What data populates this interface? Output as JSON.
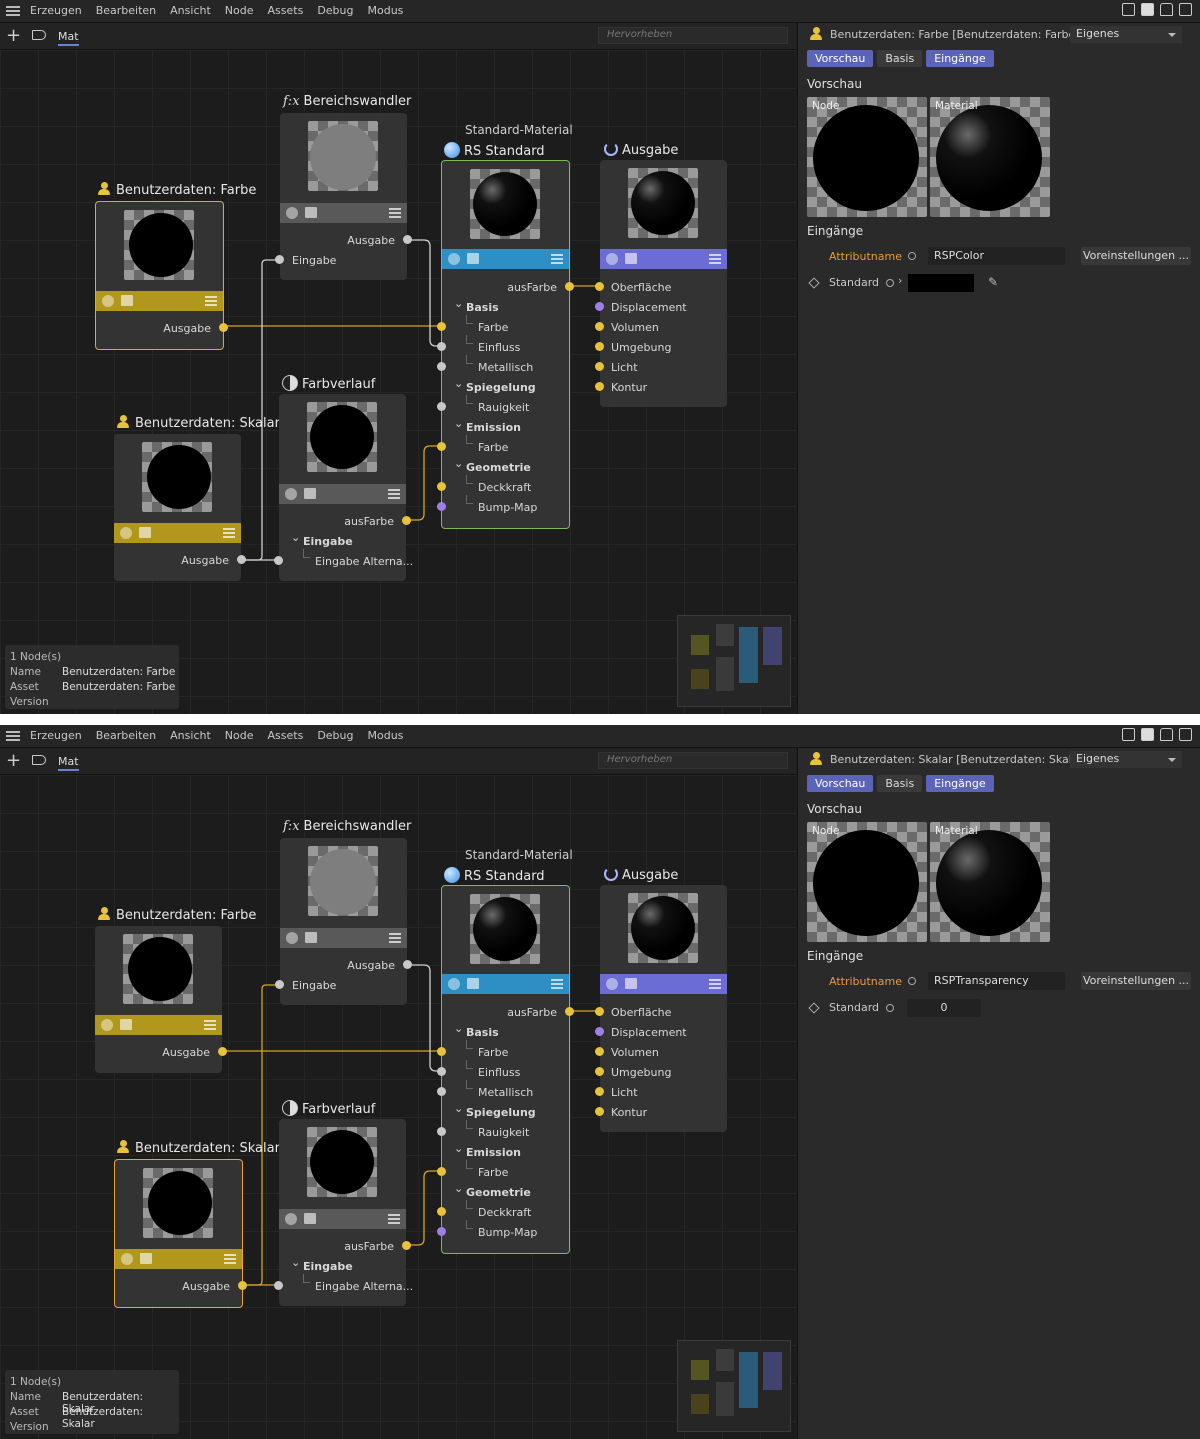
{
  "menu": [
    "Erzeugen",
    "Bearbeiten",
    "Ansicht",
    "Node",
    "Assets",
    "Debug",
    "Modus"
  ],
  "toolbar": {
    "tab": "Mat",
    "search_placeholder": "Hervorheben"
  },
  "nodes": {
    "range": {
      "title": "Bereichswandler",
      "out": "Ausgabe",
      "in": "Eingabe"
    },
    "farbe": {
      "title": "Benutzerdaten: Farbe",
      "out": "Ausgabe"
    },
    "skalar": {
      "title": "Benutzerdaten: Skalar",
      "out": "Ausgabe"
    },
    "gradient": {
      "title": "Farbverlauf",
      "out": "ausFarbe",
      "group": "Eingabe",
      "in": "Eingabe Alterna..."
    },
    "rs": {
      "subtitle": "Standard-Material",
      "title": "RS Standard",
      "out": "ausFarbe",
      "groups": [
        "Basis",
        "Spiegelung",
        "Emission",
        "Geometrie"
      ],
      "basis": [
        "Farbe",
        "Einfluss",
        "Metallisch"
      ],
      "spiegelung": [
        "Rauigkeit"
      ],
      "emission": [
        "Farbe"
      ],
      "geometrie": [
        "Deckkraft",
        "Bump-Map"
      ]
    },
    "out": {
      "title": "Ausgabe",
      "ports": [
        "Oberfläche",
        "Displacement",
        "Volumen",
        "Umgebung",
        "Licht",
        "Kontur"
      ]
    }
  },
  "colors": {
    "yellow_bar": "#b2971d",
    "grey_bar": "#595959",
    "rs_bar": "#2d8fc4",
    "out_bar": "#6b6dd4",
    "wire": "#d4a32a",
    "sel": "#e8a33c"
  },
  "shots": [
    {
      "info": {
        "count": "1 Node(s)",
        "name_lbl": "Name",
        "asset_lbl": "Asset",
        "version_lbl": "Version",
        "name": "Benutzerdaten: Farbe",
        "asset": "Benutzerdaten: Farbe"
      },
      "panel": {
        "title": "Benutzerdaten: Farbe [Benutzerdaten: Farbe]",
        "mode": "Eigenes",
        "tabs": [
          "Vorschau",
          "Basis",
          "Eingänge"
        ],
        "vorschau": "Vorschau",
        "node_lbl": "Node",
        "mat_lbl": "Material",
        "eingaenge": "Eingänge",
        "attr_lbl": "Attributname",
        "attr_val": "RSPColor",
        "preset": "Voreinstellungen ...",
        "std_lbl": "Standard",
        "std_val": ""
      }
    },
    {
      "info": {
        "count": "1 Node(s)",
        "name_lbl": "Name",
        "asset_lbl": "Asset",
        "version_lbl": "Version",
        "name": "Benutzerdaten: Skalar",
        "asset": "Benutzerdaten: Skalar"
      },
      "panel": {
        "title": "Benutzerdaten: Skalar [Benutzerdaten: Skalar]",
        "mode": "Eigenes",
        "tabs": [
          "Vorschau",
          "Basis",
          "Eingänge"
        ],
        "vorschau": "Vorschau",
        "node_lbl": "Node",
        "mat_lbl": "Material",
        "eingaenge": "Eingänge",
        "attr_lbl": "Attributname",
        "attr_val": "RSPTransparency",
        "preset": "Voreinstellungen ...",
        "std_lbl": "Standard",
        "std_val": "0"
      }
    }
  ]
}
